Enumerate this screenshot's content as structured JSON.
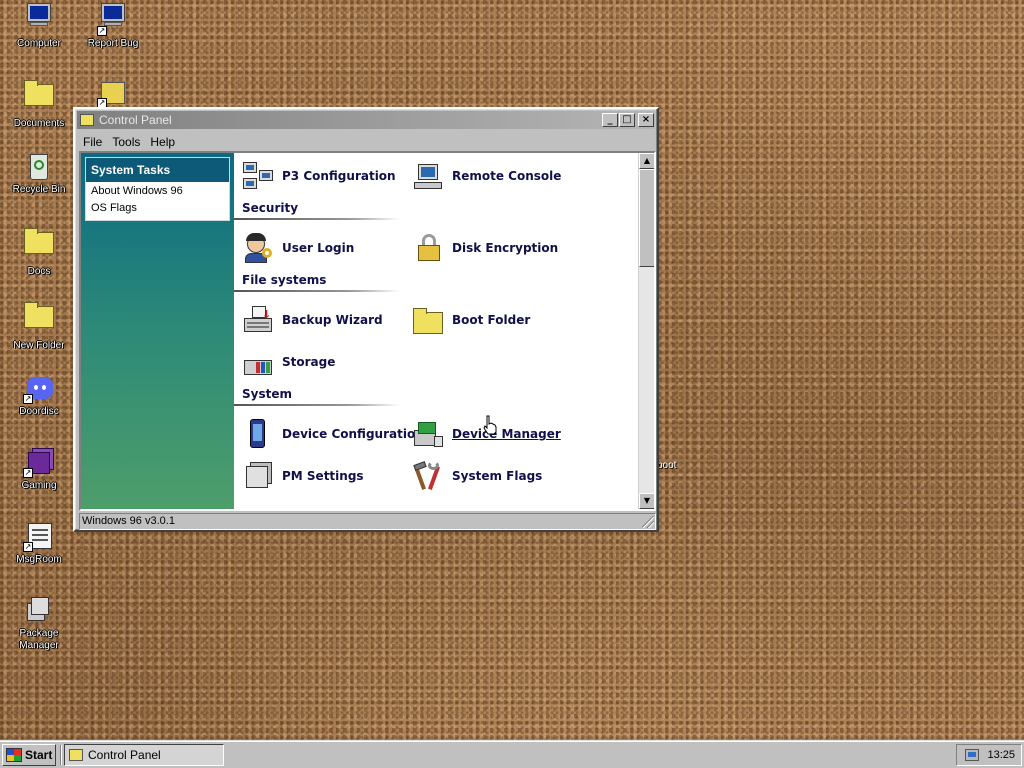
{
  "desktop": {
    "icons": [
      {
        "label": "Computer",
        "icon": "computer-icon"
      },
      {
        "label": "Report Bug",
        "icon": "report-bug-icon"
      },
      {
        "label": "Documents",
        "icon": "folder-icon"
      },
      {
        "label": "Recycle Bin",
        "icon": "recycle-bin-icon"
      },
      {
        "label": "Docs",
        "icon": "folder-icon"
      },
      {
        "label": "New Folder",
        "icon": "folder-icon"
      },
      {
        "label": "Doordisc",
        "icon": "discord-icon"
      },
      {
        "label": "Gaming",
        "icon": "gaming-cube-icon"
      },
      {
        "label": "MsgRoom",
        "icon": "msgroom-icon"
      },
      {
        "label": "Package Manager",
        "icon": "package-manager-icon"
      }
    ],
    "stray_label": "boot"
  },
  "window": {
    "title": "Control Panel",
    "controls": {
      "minimize": "_",
      "maximize": "□",
      "close": "×"
    },
    "menu": [
      "File",
      "Tools",
      "Help"
    ],
    "sidebar": {
      "header": "System Tasks",
      "items": [
        "About Windows 96",
        "OS Flags"
      ]
    },
    "content": {
      "items": {
        "p3_configuration": "P3 Configuration",
        "remote_console": "Remote Console",
        "user_login": "User Login",
        "disk_encryption": "Disk Encryption",
        "backup_wizard": "Backup Wizard",
        "boot_folder": "Boot Folder",
        "storage": "Storage",
        "device_configuration": "Device Configuration",
        "device_manager": "Device Manager",
        "pm_settings": "PM Settings",
        "system_flags": "System Flags"
      },
      "sections": {
        "security": "Security",
        "file_systems": "File systems",
        "system": "System"
      },
      "hovered_item": "Device Manager"
    },
    "scrollbar": {
      "up": "▲",
      "down": "▼"
    },
    "status_text": "Windows 96 v3.0.1"
  },
  "taskbar": {
    "start_label": "Start",
    "tasks": [
      {
        "label": "Control Panel"
      }
    ],
    "clock": "13:25"
  }
}
